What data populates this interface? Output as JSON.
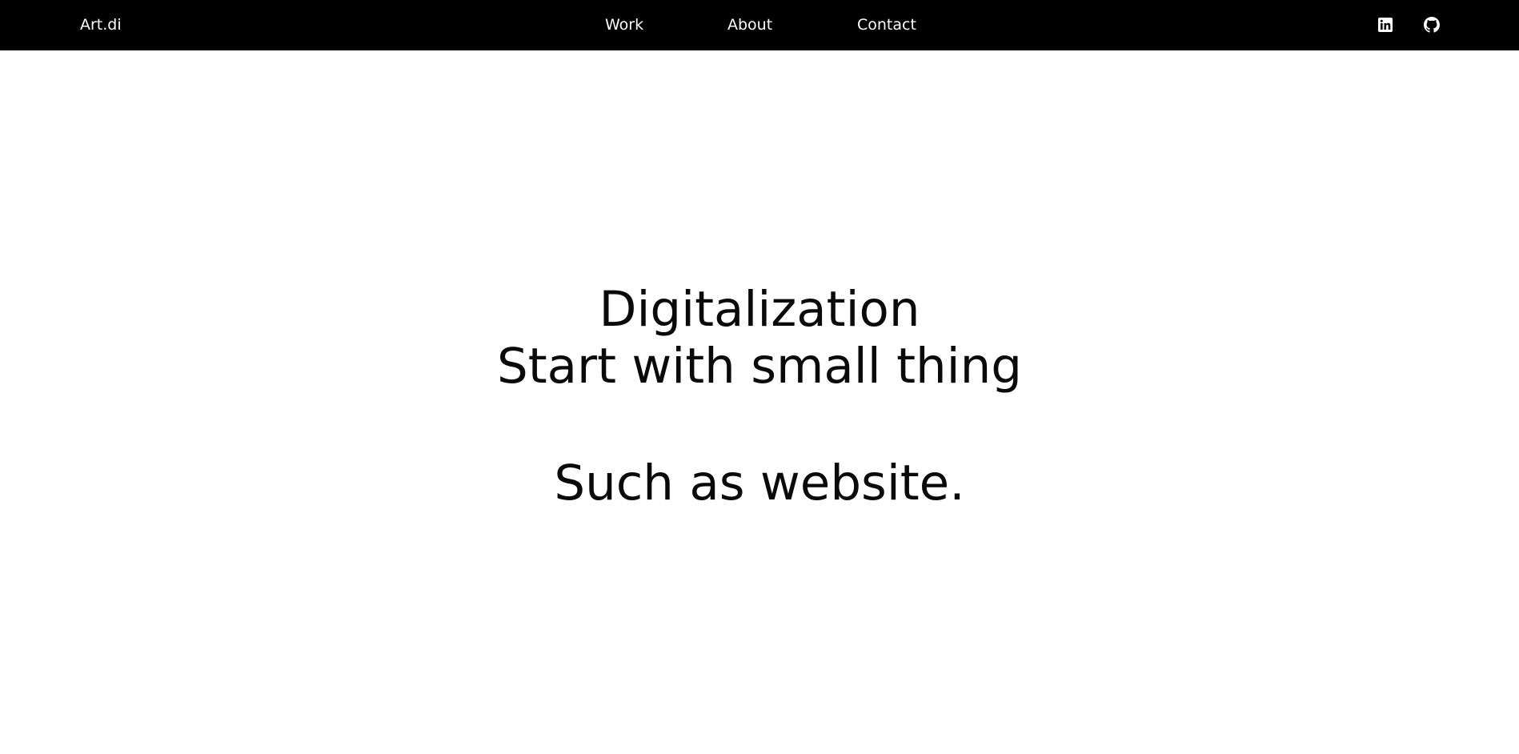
{
  "navbar": {
    "brand": "Art.di",
    "links": [
      {
        "label": "Work"
      },
      {
        "label": "About"
      },
      {
        "label": "Contact"
      }
    ],
    "social": [
      {
        "icon": "linkedin-icon"
      },
      {
        "icon": "github-icon"
      }
    ],
    "background_color": "#000000",
    "text_color": "#ffffff"
  },
  "hero": {
    "line1": "Digitalization",
    "line2": "Start with small thing",
    "line3": "Such as website."
  }
}
